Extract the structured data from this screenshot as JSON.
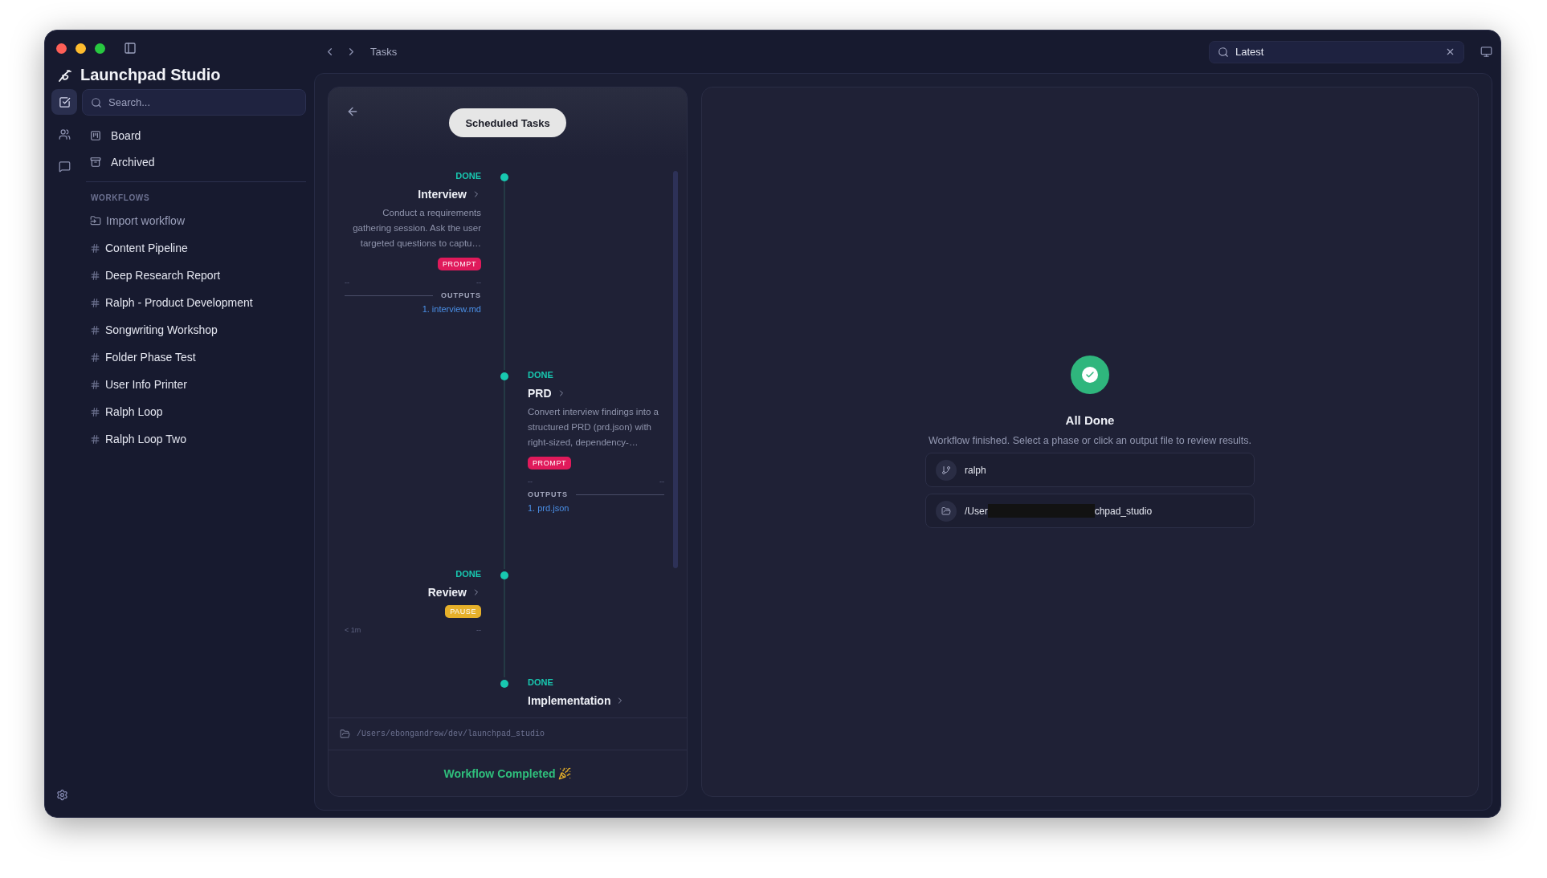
{
  "app": {
    "title": "Launchpad Studio"
  },
  "sidebar": {
    "search": {
      "placeholder": "Search..."
    },
    "rail": [
      {
        "kind": "tasks",
        "selected": true
      },
      {
        "kind": "people",
        "selected": false
      },
      {
        "kind": "chat",
        "selected": false
      }
    ],
    "nav": [
      {
        "kind": "board",
        "label": "Board"
      },
      {
        "kind": "archive",
        "label": "Archived"
      }
    ],
    "section_title": "WORKFLOWS",
    "import_label": "Import workflow",
    "workflows": [
      "Content Pipeline",
      "Deep Research Report",
      "Ralph - Product Development",
      "Songwriting Workshop",
      "Folder Phase Test",
      "User Info Printer",
      "Ralph Loop",
      "Ralph Loop Two"
    ]
  },
  "topbar": {
    "breadcrumb": "Tasks",
    "search": {
      "value": "Latest"
    }
  },
  "timeline": {
    "header": "Scheduled Tasks",
    "phases": [
      {
        "status": "DONE",
        "title": "Interview",
        "description": "Conduct a requirements gathering session. Ask the user targeted questions to captu…",
        "tag": {
          "kind": "prompt",
          "label": "PROMPT"
        },
        "meta_start": "--",
        "meta_end": "--",
        "outputs_label": "OUTPUTS",
        "outputs": [
          "1. interview.md"
        ]
      },
      {
        "status": "DONE",
        "title": "PRD",
        "description": "Convert interview findings into a structured PRD (prd.json) with right-sized, dependency-…",
        "tag": {
          "kind": "prompt",
          "label": "PROMPT"
        },
        "meta_start": "--",
        "meta_end": "--",
        "outputs_label": "OUTPUTS",
        "outputs": [
          "1. prd.json"
        ]
      },
      {
        "status": "DONE",
        "title": "Review",
        "tag": {
          "kind": "pause",
          "label": "PAUSE"
        },
        "meta_start": "< 1m",
        "meta_end": "--"
      },
      {
        "status": "DONE",
        "title": "Implementation"
      }
    ],
    "path": "/Users/ebongandrew/dev/launchpad_studio",
    "completed": "Workflow Completed"
  },
  "summary": {
    "title": "All Done",
    "message": "Workflow finished. Select a phase or click an output file to review results.",
    "items": [
      {
        "kind": "branch",
        "text": "ralph"
      },
      {
        "kind": "folder",
        "text": "/User",
        "text_after": "chpad_studio",
        "redacted": true
      }
    ]
  }
}
